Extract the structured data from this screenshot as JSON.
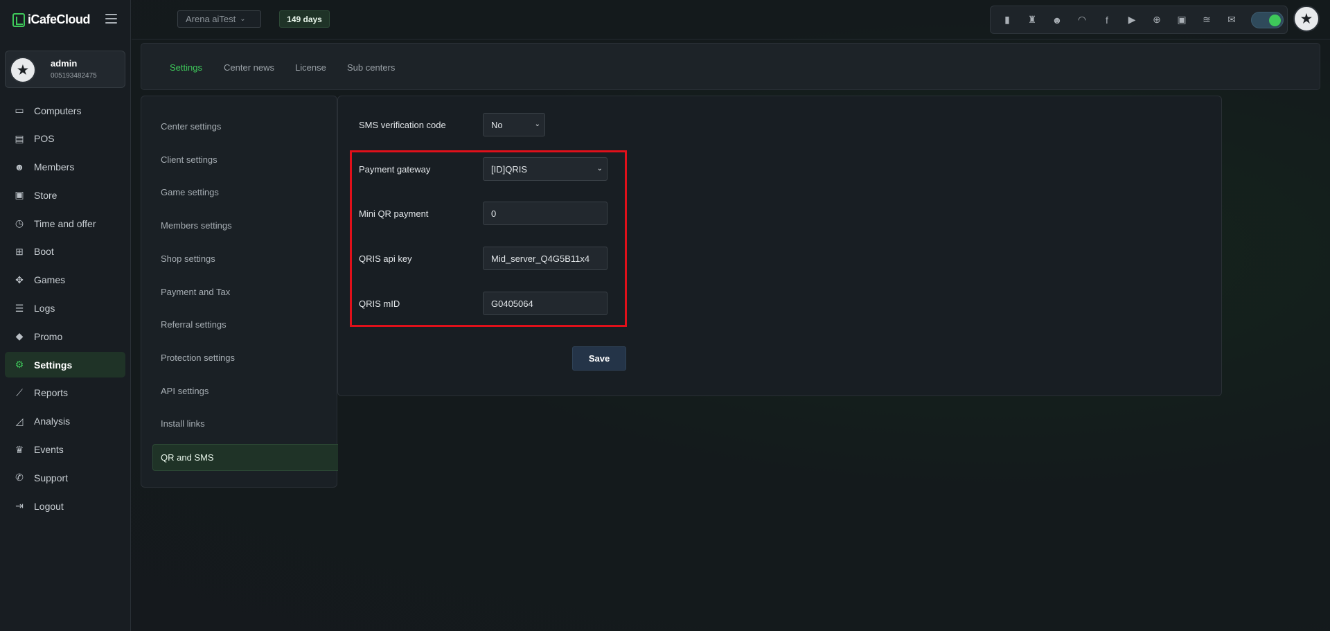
{
  "brand": {
    "name": "iCafeCloud"
  },
  "profile": {
    "name": "admin",
    "id": "005193482475"
  },
  "sidebar": {
    "items": [
      {
        "label": "Computers",
        "icon": "monitor-icon"
      },
      {
        "label": "POS",
        "icon": "register-icon"
      },
      {
        "label": "Members",
        "icon": "users-icon"
      },
      {
        "label": "Store",
        "icon": "bag-icon"
      },
      {
        "label": "Time and offer",
        "icon": "timer-icon"
      },
      {
        "label": "Boot",
        "icon": "windows-icon"
      },
      {
        "label": "Games",
        "icon": "gamepad-icon"
      },
      {
        "label": "Logs",
        "icon": "list-icon"
      },
      {
        "label": "Promo",
        "icon": "tag-icon"
      },
      {
        "label": "Settings",
        "icon": "gear-icon",
        "active": true
      },
      {
        "label": "Reports",
        "icon": "line-chart-icon"
      },
      {
        "label": "Analysis",
        "icon": "area-chart-icon"
      },
      {
        "label": "Events",
        "icon": "crown-icon"
      },
      {
        "label": "Support",
        "icon": "phone-icon"
      },
      {
        "label": "Logout",
        "icon": "logout-icon"
      }
    ]
  },
  "topbar": {
    "center": "Arena aiTest",
    "days": "149 days",
    "icons": [
      "ranking-icon",
      "trophy-icon",
      "group-icon",
      "rss-icon",
      "facebook-icon",
      "youtube-icon",
      "globe-icon",
      "icafe-icon",
      "eye-off-icon",
      "mail-icon"
    ],
    "toggle_on": true
  },
  "tabs": [
    {
      "label": "Settings",
      "active": true
    },
    {
      "label": "Center news"
    },
    {
      "label": "License"
    },
    {
      "label": "Sub centers"
    }
  ],
  "settings_menu": [
    "Center settings",
    "Client settings",
    "Game settings",
    "Members settings",
    "Shop settings",
    "Payment and Tax",
    "Referral settings",
    "Protection settings",
    "API settings",
    "Install links",
    "QR and SMS"
  ],
  "form": {
    "sms_label": "SMS verification code",
    "sms_value": "No",
    "gateway_label": "Payment gateway",
    "gateway_value": "[ID]QRIS",
    "mini_qr_label": "Mini QR payment",
    "mini_qr_value": "0",
    "api_key_label": "QRIS api key",
    "api_key_value": "Mid_server_Q4G5B11x4",
    "mid_label": "QRIS mID",
    "mid_value": "G0405064",
    "save_label": "Save"
  },
  "colors": {
    "accent": "#3ec85a",
    "highlight": "#e0101a",
    "save_button": "#243448"
  }
}
